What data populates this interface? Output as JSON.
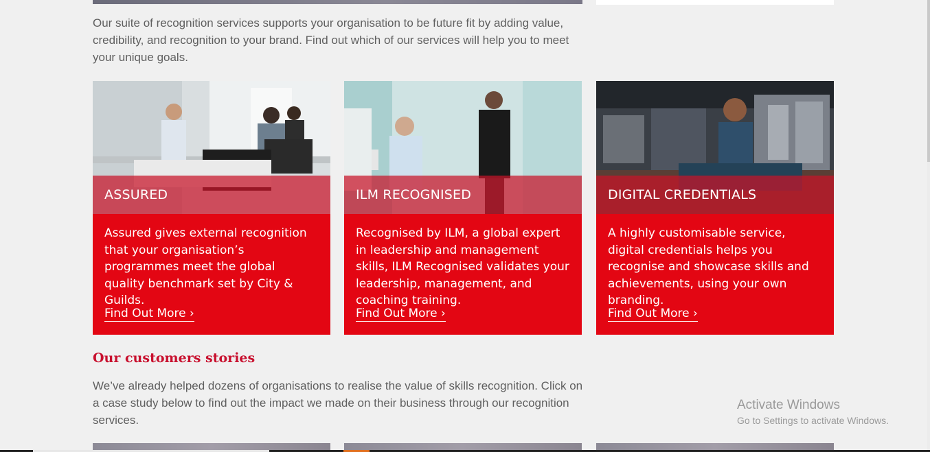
{
  "intro": {
    "text": "Our suite of recognition services supports your organisation to be future fit by adding value, credibility, and recognition to your brand. Find out which of our services will help you to meet your unique goals."
  },
  "cards": [
    {
      "title": "ASSURED",
      "body": "Assured gives external recognition that your organisation’s programmes meet the global quality benchmark set by City & Guilds.",
      "link": "Find Out More ›"
    },
    {
      "title": "ILM RECOGNISED",
      "body": "Recognised by ILM, a global expert in leadership and management skills, ILM Recognised validates your leadership, management, and coaching training.",
      "link": "Find Out More ›"
    },
    {
      "title": "DIGITAL CREDENTIALS",
      "body": "A highly customisable service, digital credentials helps you recognise and showcase skills and achievements, using your own branding.",
      "link": "Find Out More ›"
    }
  ],
  "stories": {
    "heading": "Our customers stories",
    "text": "We’ve already helped dozens of organisations to realise the value of skills recognition. Click on a case study below to find out the impact we made on their business through our recognition services."
  },
  "watermark": {
    "title": "Activate Windows",
    "subtitle": "Go to Settings to activate Windows."
  },
  "colors": {
    "brand_red": "#e30613",
    "heading_red": "#c8102e",
    "background": "#f0f0f0"
  }
}
